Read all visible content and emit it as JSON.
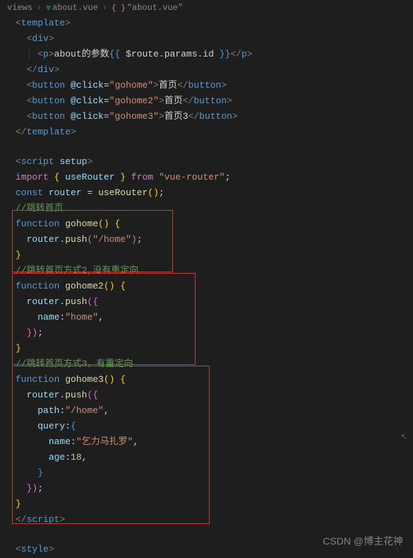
{
  "breadcrumbs": {
    "part1": "views",
    "part2": "about.vue",
    "part3": "\"about.vue\""
  },
  "code": {
    "tpl_open": "template",
    "div": "div",
    "p": "p",
    "about_text": "about的参数",
    "route_expr": " $route.params.id ",
    "button": "button",
    "at_click": "@click",
    "gohome": "gohome",
    "gohome2": "gohome2",
    "gohome3": "gohome3",
    "btn1_text": "首页",
    "btn2_text": "首页",
    "btn3_text": "首页3",
    "script": "script",
    "setup": "setup",
    "import": "import",
    "from": "from",
    "useRouter": "useRouter",
    "vue_router": "\"vue-router\"",
    "const": "const",
    "router": "router",
    "comment1": "//跳转首页",
    "function": "function",
    "push": "push",
    "home_path": "\"/home\"",
    "comment2": "//跳转首页方式2,没有重定向",
    "name": "name",
    "home": "\"home\"",
    "comment3": "//跳转首页方式3，有重定向",
    "path": "path",
    "query": "query",
    "name_val": "\"乞力马扎罗\"",
    "age": "age",
    "age_val": "18",
    "style": "style"
  },
  "watermark": "CSDN @博主花神"
}
